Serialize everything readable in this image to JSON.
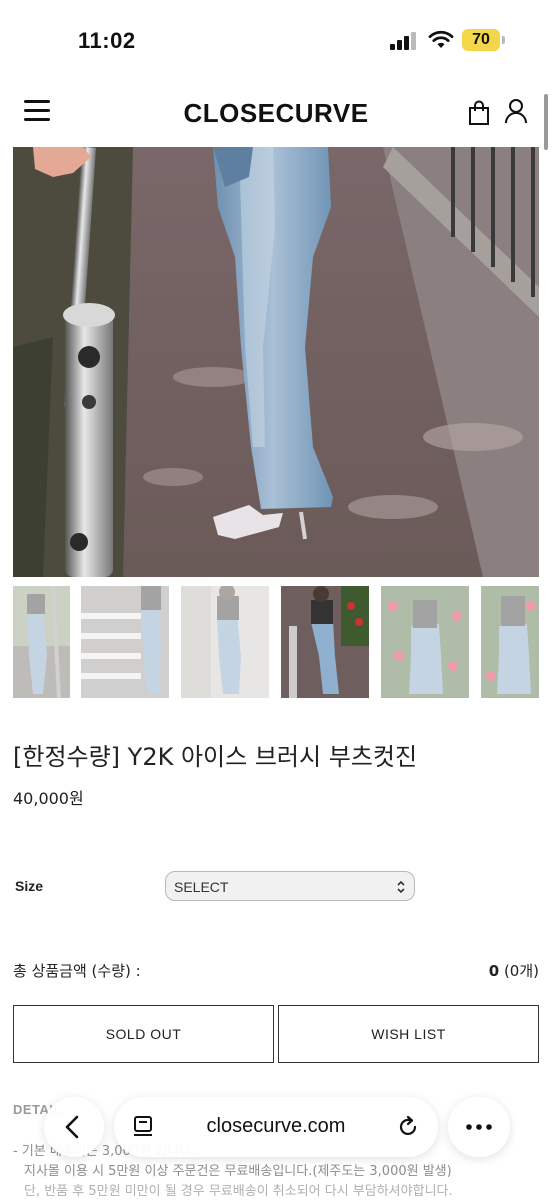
{
  "status_bar": {
    "time": "11:02",
    "battery": "70"
  },
  "header": {
    "brand": "CLOSECURVE"
  },
  "product": {
    "title": "[한정수량] Y2K 아이스 브러시 부츠컷진",
    "price": "40,000원"
  },
  "options": {
    "size_label": "Size",
    "size_selected": "SELECT"
  },
  "total": {
    "label": "총 상품금액 (수량) :",
    "amount": "0",
    "count": "(0개)"
  },
  "buttons": {
    "sold_out": "SOLD OUT",
    "wish_list": "WISH LIST"
  },
  "details": {
    "tab_detail": "DETAIL",
    "line1": "- 기본 배송비는 3,000원 입니다.",
    "line2": "지사몰 이용 시 5만원 이상 주문건은 무료배송입니다.(제주도는 3,000원 발생)",
    "line3": "단, 반품 후 5만원 미만이 될 경우 무료배송이 취소되어 다시 부담하셔야합니다."
  },
  "browser": {
    "url": "closecurve.com"
  },
  "icons": [
    "menu-icon",
    "shopping-bag-icon",
    "user-icon",
    "back-arrow-icon",
    "reader-icon",
    "reload-icon",
    "more-icon"
  ],
  "colors": {
    "battery": "#f4d64a",
    "text": "#222222",
    "border": "#333333"
  }
}
